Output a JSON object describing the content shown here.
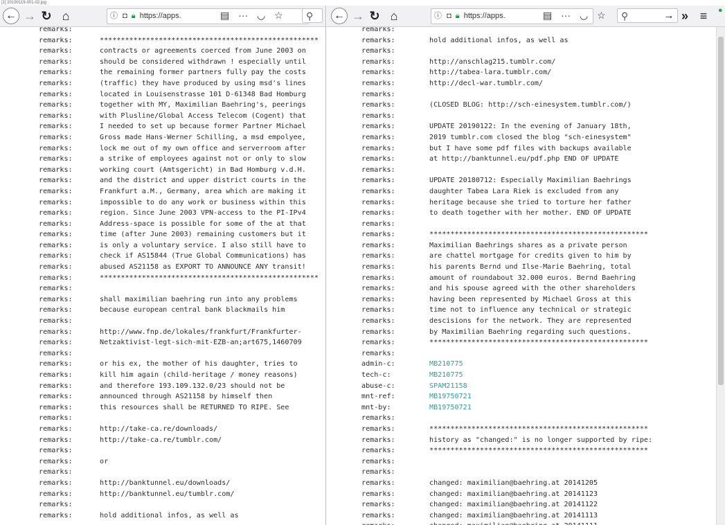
{
  "file_label": "[1] 20190119-001-02.jpg",
  "left": {
    "toolbar": {
      "url_prefix": "https://apps.",
      "menu_glyph": "≡"
    },
    "scroll_thumb": {
      "start": 0.06,
      "end": 0.98
    },
    "lines": [
      {
        "k": "remarks:",
        "v": ""
      },
      {
        "k": "remarks:",
        "v": "****************************************************"
      },
      {
        "k": "remarks:",
        "v": "contracts or agreements coerced from June 2003 on"
      },
      {
        "k": "remarks:",
        "v": "should be considered withdrawn ! especially until"
      },
      {
        "k": "remarks:",
        "v": "the remaining former partners fully pay the costs"
      },
      {
        "k": "remarks:",
        "v": "(traffic) they have produced by using msd's lines"
      },
      {
        "k": "remarks:",
        "v": "located in Louisenstrasse 101 D-61348 Bad Homburg"
      },
      {
        "k": "remarks:",
        "v": "together with MY, Maximilian Baehring's, peerings"
      },
      {
        "k": "remarks:",
        "v": "with Plusline/Global Access Telecom (Cogent) that"
      },
      {
        "k": "remarks:",
        "v": "I needed to set up because former Partner Michael"
      },
      {
        "k": "remarks:",
        "v": "Gross made Hans-Werner Schilling, a msd empolyee,"
      },
      {
        "k": "remarks:",
        "v": "lock me out of my own office and serverroom after"
      },
      {
        "k": "remarks:",
        "v": "a strike of employees against not or only to slow"
      },
      {
        "k": "remarks:",
        "v": "working court (Amtsgericht) in Bad Homburg v.d.H."
      },
      {
        "k": "remarks:",
        "v": "and the district and upper district courts in the"
      },
      {
        "k": "remarks:",
        "v": "Frankfurt a.M., Germany, area which are making it"
      },
      {
        "k": "remarks:",
        "v": "impossible to do any work or business within this"
      },
      {
        "k": "remarks:",
        "v": "region. Since June 2003 VPN-access to the PI-IPv4"
      },
      {
        "k": "remarks:",
        "v": "Address-space is possible for some of the at that"
      },
      {
        "k": "remarks:",
        "v": "time (after June 2003) remaining customers but it"
      },
      {
        "k": "remarks:",
        "v": "is only a voluntary service. I also still have to"
      },
      {
        "k": "remarks:",
        "v": "check if AS15844 (True Global Communications) has"
      },
      {
        "k": "remarks:",
        "v": "abused AS21158 as EXPORT TO ANNOUNCE ANY transit!"
      },
      {
        "k": "remarks:",
        "v": "****************************************************"
      },
      {
        "k": "remarks:",
        "v": ""
      },
      {
        "k": "remarks:",
        "v": "shall maximilian baehring run into any problems"
      },
      {
        "k": "remarks:",
        "v": "because european central bank blackmails him"
      },
      {
        "k": "remarks:",
        "v": ""
      },
      {
        "k": "remarks:",
        "v": "http://www.fnp.de/lokales/frankfurt/Frankfurter-"
      },
      {
        "k": "remarks:",
        "v": "Netzaktivist-legt-sich-mit-EZB-an;art675,1460709"
      },
      {
        "k": "remarks:",
        "v": ""
      },
      {
        "k": "remarks:",
        "v": "or his ex, the mother of his daughter, tries to"
      },
      {
        "k": "remarks:",
        "v": "kill him again (child-heritage / money reasons)"
      },
      {
        "k": "remarks:",
        "v": "and therefore 193.109.132.0/23 should not be"
      },
      {
        "k": "remarks:",
        "v": "announced through AS21158 by himself then"
      },
      {
        "k": "remarks:",
        "v": "this resources shall be RETURNED TO RIPE. See"
      },
      {
        "k": "remarks:",
        "v": ""
      },
      {
        "k": "remarks:",
        "v": "http://take-ca.re/downloads/"
      },
      {
        "k": "remarks:",
        "v": "http://take-ca.re/tumblr.com/"
      },
      {
        "k": "remarks:",
        "v": ""
      },
      {
        "k": "remarks:",
        "v": "or"
      },
      {
        "k": "remarks:",
        "v": ""
      },
      {
        "k": "remarks:",
        "v": "http://banktunnel.eu/downloads/"
      },
      {
        "k": "remarks:",
        "v": "http://banktunnel.eu/tumblr.com/"
      },
      {
        "k": "remarks:",
        "v": ""
      },
      {
        "k": "remarks:",
        "v": "hold additional infos, as well as"
      }
    ]
  },
  "right": {
    "toolbar": {
      "url_prefix": "https://apps.",
      "more_glyph": "»",
      "menu_glyph": "≡"
    },
    "scroll_thumb": {
      "start": 0.02,
      "end": 0.72
    },
    "lines": [
      {
        "k": "remarks:",
        "v": ""
      },
      {
        "k": "remarks:",
        "v": "hold additional infos, as well as"
      },
      {
        "k": "remarks:",
        "v": ""
      },
      {
        "k": "remarks:",
        "v": "http://anschlag215.tumblr.com/"
      },
      {
        "k": "remarks:",
        "v": "http://tabea-lara.tumblr.com/"
      },
      {
        "k": "remarks:",
        "v": "http://decl-war.tumblr.com/"
      },
      {
        "k": "remarks:",
        "v": ""
      },
      {
        "k": "remarks:",
        "v": "(CLOSED BLOG: http://sch-einesystem.tumblr.com/)"
      },
      {
        "k": "remarks:",
        "v": ""
      },
      {
        "k": "remarks:",
        "v": "UPDATE 20190122: In the evening of January 18th,"
      },
      {
        "k": "remarks:",
        "v": "2019 tumblr.com closed the blog \"sch-einesystem\""
      },
      {
        "k": "remarks:",
        "v": "but I have some pdf files with backups available"
      },
      {
        "k": "remarks:",
        "v": "at http://banktunnel.eu/pdf.php END OF UPDATE"
      },
      {
        "k": "remarks:",
        "v": ""
      },
      {
        "k": "remarks:",
        "v": "UPDATE 20180712: Especially Maximilian Baehrings"
      },
      {
        "k": "remarks:",
        "v": "daughter Tabea Lara Riek is excluded from any"
      },
      {
        "k": "remarks:",
        "v": "heritage because she tried to torture her father"
      },
      {
        "k": "remarks:",
        "v": "to death together with her mother. END OF UPDATE"
      },
      {
        "k": "remarks:",
        "v": ""
      },
      {
        "k": "remarks:",
        "v": "****************************************************"
      },
      {
        "k": "remarks:",
        "v": "Maximilian Baehrings shares as a private person"
      },
      {
        "k": "remarks:",
        "v": "are chattel mortgage for credits given to him by"
      },
      {
        "k": "remarks:",
        "v": "his parents Bernd und Ilse-Marie Baehring, total"
      },
      {
        "k": "remarks:",
        "v": "amount of roundabout 32.000 euros. Bernd Baehring"
      },
      {
        "k": "remarks:",
        "v": "and his spouse agreed with the other shareholders"
      },
      {
        "k": "remarks:",
        "v": "having been represented by Michael Gross at this"
      },
      {
        "k": "remarks:",
        "v": "time not to influence any technical or strategic"
      },
      {
        "k": "remarks:",
        "v": "descisions for the network. They are represented"
      },
      {
        "k": "remarks:",
        "v": "by Maximilian Baehring regarding such questions."
      },
      {
        "k": "remarks:",
        "v": "****************************************************"
      },
      {
        "k": "remarks:",
        "v": ""
      },
      {
        "k": "admin-c:",
        "v": "MB210775",
        "link": true
      },
      {
        "k": "tech-c:",
        "v": "MB210775",
        "link": true
      },
      {
        "k": "abuse-c:",
        "v": "SPAM21158",
        "link": true
      },
      {
        "k": "mnt-ref:",
        "v": "MB19750721",
        "link": true
      },
      {
        "k": "mnt-by:",
        "v": "MB19750721",
        "link": true
      },
      {
        "k": "remarks:",
        "v": ""
      },
      {
        "k": "remarks:",
        "v": "****************************************************"
      },
      {
        "k": "remarks:",
        "v": "history as \"changed:\" is no longer supported by ripe:"
      },
      {
        "k": "remarks:",
        "v": "****************************************************"
      },
      {
        "k": "remarks:",
        "v": ""
      },
      {
        "k": "remarks:",
        "v": ""
      },
      {
        "k": "remarks:",
        "v": "changed: maximilian@baehring.at 20141205"
      },
      {
        "k": "remarks:",
        "v": "changed: maximilian@baehring.at 20141123"
      },
      {
        "k": "remarks:",
        "v": "changed: maximilian@baehring.at 20141122"
      },
      {
        "k": "remarks:",
        "v": "changed: maximilian@baehring.at 20141113"
      },
      {
        "k": "remarks:",
        "v": "changed: maximilian@baehring.at 20141111"
      }
    ]
  }
}
